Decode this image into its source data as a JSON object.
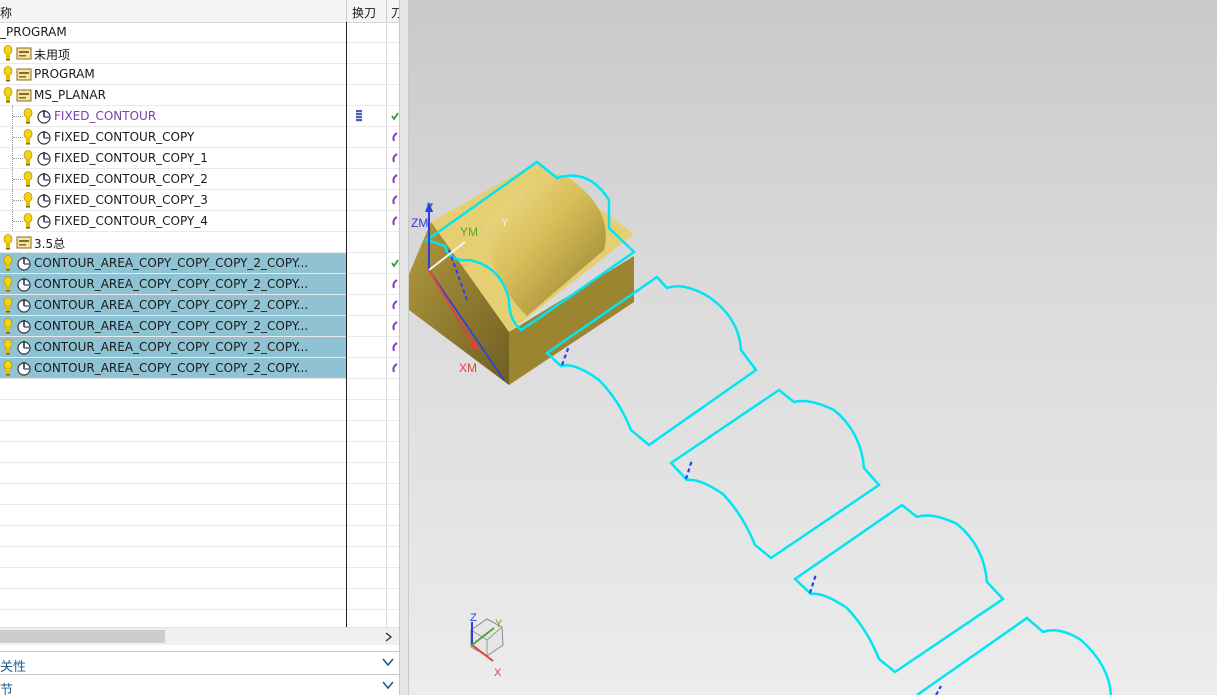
{
  "navigator": {
    "columns": {
      "name": "称",
      "tool_change": "换刀",
      "path": "刀"
    },
    "rows": [
      {
        "label": "_PROGRAM",
        "level": 0,
        "type": "root"
      },
      {
        "label": "未用项",
        "level": 1,
        "type": "group"
      },
      {
        "label": "PROGRAM",
        "level": 1,
        "type": "group"
      },
      {
        "label": "MS_PLANAR",
        "level": 1,
        "type": "group"
      },
      {
        "label": "FIXED_CONTOUR",
        "level": 2,
        "type": "op",
        "highlight": true
      },
      {
        "label": "FIXED_CONTOUR_COPY",
        "level": 2,
        "type": "op"
      },
      {
        "label": "FIXED_CONTOUR_COPY_1",
        "level": 2,
        "type": "op"
      },
      {
        "label": "FIXED_CONTOUR_COPY_2",
        "level": 2,
        "type": "op"
      },
      {
        "label": "FIXED_CONTOUR_COPY_3",
        "level": 2,
        "type": "op"
      },
      {
        "label": "FIXED_CONTOUR_COPY_4",
        "level": 2,
        "type": "op"
      },
      {
        "label": "3.5总",
        "level": 1,
        "type": "group"
      },
      {
        "label": "CONTOUR_AREA_COPY_COPY_COPY_2_COPY...",
        "level": 1,
        "type": "op",
        "selected": true
      },
      {
        "label": "CONTOUR_AREA_COPY_COPY_COPY_2_COPY...",
        "level": 1,
        "type": "op",
        "selected": true
      },
      {
        "label": "CONTOUR_AREA_COPY_COPY_COPY_2_COPY...",
        "level": 1,
        "type": "op",
        "selected": true
      },
      {
        "label": "CONTOUR_AREA_COPY_COPY_COPY_2_COPY...",
        "level": 1,
        "type": "op",
        "selected": true
      },
      {
        "label": "CONTOUR_AREA_COPY_COPY_COPY_2_COPY...",
        "level": 1,
        "type": "op",
        "selected": true
      },
      {
        "label": "CONTOUR_AREA_COPY_COPY_COPY_2_COPY...",
        "level": 1,
        "type": "op",
        "selected": true
      }
    ]
  },
  "panels": {
    "dependencies": "关性",
    "details": "节"
  },
  "viewport": {
    "wcs_labels": {
      "zm": "ZM",
      "ym": "YM",
      "xm": "XM",
      "z": "Z",
      "y": "Y"
    },
    "triad_labels": {
      "z": "Z",
      "y": "Y",
      "x": "X"
    }
  },
  "colors": {
    "selection": "#8fc3d3",
    "toolpath": "#00e5f5",
    "part": "#c9b04a",
    "highlight_text": "#7a3fb3"
  }
}
